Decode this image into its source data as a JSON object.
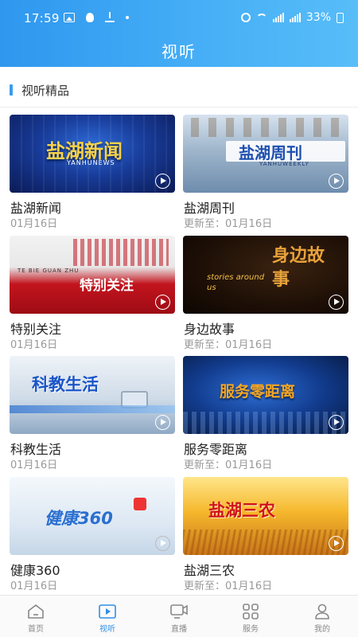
{
  "status_bar": {
    "time": "17:59",
    "battery": "33%"
  },
  "header": {
    "title": "视听"
  },
  "section": {
    "title": "视听精品"
  },
  "cards": [
    {
      "title": "盐湖新闻",
      "date": "01月16日",
      "thumb_text": "盐湖新闻",
      "thumb_sub": "YANHUNEWS"
    },
    {
      "title": "盐湖周刊",
      "date": "更新至：01月16日",
      "thumb_text": "盐湖周刊",
      "thumb_sub": "YANHUWEEKLY"
    },
    {
      "title": "特别关注",
      "date": "01月16日",
      "thumb_text": "特别关注",
      "thumb_sub": "TE BIE GUAN ZHU"
    },
    {
      "title": "身边故事",
      "date": "更新至：01月16日",
      "thumb_text": "身边故事",
      "thumb_sub": "stories around us"
    },
    {
      "title": "科教生活",
      "date": "01月16日",
      "thumb_text": "科教生活",
      "thumb_sub": ""
    },
    {
      "title": "服务零距离",
      "date": "更新至：01月16日",
      "thumb_text": "服务零距离",
      "thumb_sub": ""
    },
    {
      "title": "健康360",
      "date": "01月16日",
      "thumb_text": "健康360",
      "thumb_sub": ""
    },
    {
      "title": "盐湖三农",
      "date": "更新至：01月16日",
      "thumb_text": "盐湖三农",
      "thumb_sub": ""
    }
  ],
  "bottom_nav": [
    {
      "label": "首页",
      "icon": "home-icon",
      "active": false
    },
    {
      "label": "视听",
      "icon": "video-icon",
      "active": true
    },
    {
      "label": "直播",
      "icon": "live-icon",
      "active": false
    },
    {
      "label": "服务",
      "icon": "grid-icon",
      "active": false
    },
    {
      "label": "我的",
      "icon": "user-icon",
      "active": false
    }
  ],
  "colors": {
    "header_start": "#2f97ee",
    "header_end": "#58bdf8",
    "accent": "#3a9cf0",
    "nav_active": "#2f8fe8"
  }
}
